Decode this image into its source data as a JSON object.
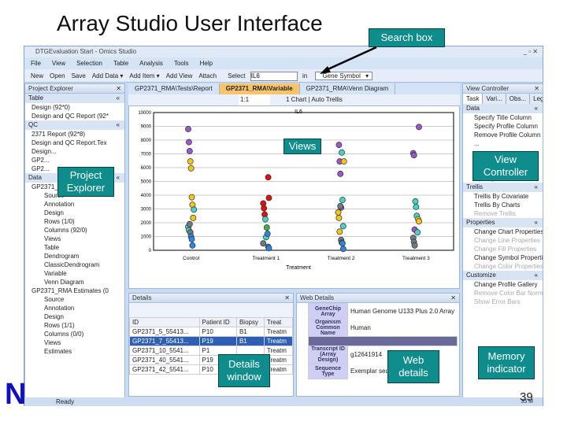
{
  "slide": {
    "title": "Array Studio User Interface",
    "slide_number": "39",
    "logo_letter": "N"
  },
  "callouts": {
    "search": "Search box",
    "views": "Views",
    "explorer": "Project Explorer",
    "controller": "View Controller",
    "details": "Details window",
    "web": "Web details",
    "memory": "Memory indicator"
  },
  "window": {
    "title": "DTGEvaluation Start - Omics Studio",
    "status": "Ready",
    "memory": "35 M"
  },
  "menu": [
    "File",
    "View",
    "Selection",
    "Table",
    "Analysis",
    "Tools",
    "Help"
  ],
  "toolbar": {
    "buttons": [
      "New",
      "Open",
      "Save",
      "Add Data ▾",
      "Add Item ▾",
      "Add View",
      "Attach"
    ],
    "select_label": "Select",
    "select_value": "IL6",
    "in_label": "in",
    "in_value": "Gene Symbol"
  },
  "explorer": {
    "title": "Project Explorer",
    "sections": [
      {
        "name": "Table",
        "items": [
          "Design (92*0)",
          "Design and QC Report (92*"
        ]
      },
      {
        "name": "QC",
        "items": [
          "2371 Report (92*8)",
          "Design and QC Report.Tex",
          "Design...",
          "GP2...",
          "GP2..."
        ]
      },
      {
        "name": "Data",
        "items": [
          "GP2371_RMA (54675*92)",
          "Source",
          "Annotation",
          "Design",
          "Rows (1/0)",
          "Columns (92/0)",
          "Views",
          "Table",
          "Dendrogram",
          "ClassicDendrogram",
          "Variable",
          "Venn Diagram",
          "GP2371_RMA Estimates (0",
          "Source",
          "Annotation",
          "Design",
          "Rows (1/1)",
          "Columns (0/0)",
          "Views",
          "Estimates"
        ]
      }
    ]
  },
  "tabs": [
    "GP2371_RMA\\Tests\\Report",
    "GP2371_RMA\\Variable",
    "GP2371_RMA\\Venn Diagram"
  ],
  "view_toolbar": {
    "zoom": "1:1",
    "chart": "1 Chart",
    "trellis": "Auto Trellis"
  },
  "chart_data": {
    "type": "scatter",
    "title": "IL6",
    "xlabel": "Treatment",
    "ylabel": "",
    "ylim": [
      0,
      10000
    ],
    "yticks": [
      0,
      1000,
      2000,
      3000,
      4000,
      5000,
      6000,
      7000,
      8000,
      9000,
      10000
    ],
    "categories": [
      "Control",
      "Treatment 1",
      "Treatment 2",
      "Treatment 3"
    ],
    "grid": true,
    "colors": {
      "purple": "#9b59c6",
      "yellow": "#f5c518",
      "teal": "#45d3c3",
      "gray": "#6e7a80",
      "blue": "#2e86de",
      "red": "#e01010",
      "green": "#3cb043"
    },
    "points": [
      [
        "Control",
        8800,
        "purple"
      ],
      [
        "Control",
        7850,
        "purple"
      ],
      [
        "Control",
        7200,
        "purple"
      ],
      [
        "Control",
        6450,
        "yellow"
      ],
      [
        "Control",
        5950,
        "yellow"
      ],
      [
        "Control",
        3850,
        "yellow"
      ],
      [
        "Control",
        3300,
        "yellow"
      ],
      [
        "Control",
        2350,
        "yellow"
      ],
      [
        "Control",
        2950,
        "teal"
      ],
      [
        "Control",
        1700,
        "teal"
      ],
      [
        "Control",
        1450,
        "teal"
      ],
      [
        "Control",
        1900,
        "gray"
      ],
      [
        "Control",
        1300,
        "gray"
      ],
      [
        "Control",
        1000,
        "blue"
      ],
      [
        "Control",
        800,
        "blue"
      ],
      [
        "Control",
        350,
        "blue"
      ],
      [
        "Treatment 1",
        5300,
        "red"
      ],
      [
        "Treatment 1",
        3800,
        "red"
      ],
      [
        "Treatment 1",
        3400,
        "red"
      ],
      [
        "Treatment 1",
        3050,
        "red"
      ],
      [
        "Treatment 1",
        2600,
        "red"
      ],
      [
        "Treatment 1",
        2250,
        "teal"
      ],
      [
        "Treatment 1",
        950,
        "teal"
      ],
      [
        "Treatment 1",
        1650,
        "green"
      ],
      [
        "Treatment 1",
        1200,
        "blue"
      ],
      [
        "Treatment 1",
        250,
        "blue"
      ],
      [
        "Treatment 1",
        150,
        "blue"
      ],
      [
        "Treatment 1",
        500,
        "gray"
      ],
      [
        "Treatment 2",
        7650,
        "purple"
      ],
      [
        "Treatment 2",
        6450,
        "purple"
      ],
      [
        "Treatment 2",
        5550,
        "purple"
      ],
      [
        "Treatment 2",
        3100,
        "purple"
      ],
      [
        "Treatment 2",
        7100,
        "teal"
      ],
      [
        "Treatment 2",
        3650,
        "teal"
      ],
      [
        "Treatment 2",
        1750,
        "teal"
      ],
      [
        "Treatment 2",
        6450,
        "yellow"
      ],
      [
        "Treatment 2",
        2750,
        "yellow"
      ],
      [
        "Treatment 2",
        2350,
        "yellow"
      ],
      [
        "Treatment 2",
        1350,
        "yellow"
      ],
      [
        "Treatment 2",
        3200,
        "gray"
      ],
      [
        "Treatment 2",
        750,
        "gray"
      ],
      [
        "Treatment 2",
        550,
        "gray"
      ],
      [
        "Treatment 2",
        500,
        "blue"
      ],
      [
        "Treatment 2",
        100,
        "blue"
      ],
      [
        "Treatment 3",
        8950,
        "purple"
      ],
      [
        "Treatment 3",
        7050,
        "purple"
      ],
      [
        "Treatment 3",
        6900,
        "purple"
      ],
      [
        "Treatment 3",
        1500,
        "purple"
      ],
      [
        "Treatment 3",
        3550,
        "teal"
      ],
      [
        "Treatment 3",
        3150,
        "teal"
      ],
      [
        "Treatment 3",
        2500,
        "teal"
      ],
      [
        "Treatment 3",
        1300,
        "teal"
      ],
      [
        "Treatment 3",
        2250,
        "yellow"
      ],
      [
        "Treatment 3",
        2100,
        "yellow"
      ],
      [
        "Treatment 3",
        900,
        "gray"
      ],
      [
        "Treatment 3",
        600,
        "gray"
      ],
      [
        "Treatment 3",
        350,
        "gray"
      ]
    ]
  },
  "controller": {
    "title": "View Controller",
    "tabs": [
      "Task",
      "Vari...",
      "Obs...",
      "Leg..."
    ],
    "sections": [
      {
        "name": "Data",
        "items": [
          [
            "Specify Title Column",
            1
          ],
          [
            "Specify Profile Column",
            1
          ],
          [
            "Remove Profile Column",
            1
          ],
          [
            "...",
            1
          ],
          [
            "...",
            1
          ],
          [
            "...",
            1
          ],
          [
            "...",
            1
          ],
          [
            "Specify Transformation",
            1
          ]
        ]
      },
      {
        "name": "Trellis",
        "items": [
          [
            "Trellis By Covariate",
            1
          ],
          [
            "Trellis By Charts",
            1
          ],
          [
            "Remove Trellis",
            0
          ]
        ]
      },
      {
        "name": "Properties",
        "items": [
          [
            "Change Chart Properties",
            1
          ],
          [
            "Change Line Properties",
            0
          ],
          [
            "Change Fill Properties",
            0
          ],
          [
            "Change Symbol Properties",
            1
          ],
          [
            "Change Color Properties",
            0
          ]
        ]
      },
      {
        "name": "Customize",
        "items": [
          [
            "Change Profile Gallery",
            1
          ],
          [
            "Remove Color Bar Normali",
            0
          ],
          [
            "Show Error Bars",
            0
          ]
        ]
      }
    ]
  },
  "details": {
    "title": "Details",
    "columns": [
      "ID",
      "Patient ID",
      "Biopsy",
      "Treat"
    ],
    "rows": [
      [
        "GP2371_5_55413...",
        "P10",
        "B1",
        "Treatm"
      ],
      [
        "GP2371_7_55413...",
        "P19",
        "B1",
        "Treatm"
      ],
      [
        "GP2371_10_5541...",
        "P1",
        "",
        "Treatm"
      ],
      [
        "GP2371_40_5541...",
        "P19",
        "",
        "Treatm"
      ],
      [
        "GP2371_42_5541...",
        "P10",
        "",
        "Treatm"
      ]
    ],
    "selected": 1
  },
  "web": {
    "title": "Web Details",
    "rows": [
      [
        "GeneChip Array",
        "Human Genome U133 Plus 2.0 Array"
      ],
      [
        "Organism Common Name",
        "Human"
      ],
      [
        "",
        ""
      ],
      [
        "Transcript ID (Array Design)",
        "g12641914"
      ],
      [
        "Sequence Type",
        "Exemplar seq..."
      ]
    ]
  }
}
